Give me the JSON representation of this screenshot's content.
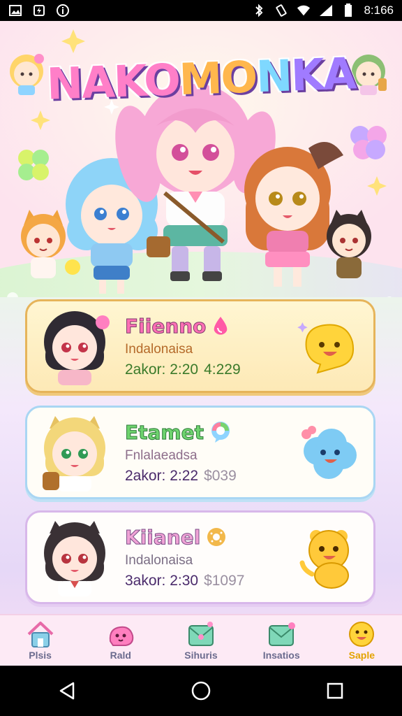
{
  "status_bar": {
    "time": "8:166",
    "left_icons": [
      "gallery-icon",
      "flash-icon",
      "info-icon"
    ],
    "right_icons": [
      "bluetooth-icon",
      "vibrate-icon",
      "wifi-icon",
      "signal-icon",
      "battery-icon"
    ]
  },
  "hero": {
    "title_parts": [
      "NAKO",
      "MO",
      "N",
      "KA"
    ],
    "title_full": "NAKOMONKA"
  },
  "cards": [
    {
      "name": "Fiienno",
      "subtitle": "Indalonaisa",
      "meta": "2akor: 2:20",
      "meta_extra": "4:229",
      "badge_icon": "droplet-icon",
      "mascot_icon": "yellow-blob-mascot-icon",
      "accent": "#ff6fb5"
    },
    {
      "name": "Etamet",
      "subtitle": "Fnlalaeadsa",
      "meta": "2akor: 2:22",
      "meta_extra": "$039",
      "badge_icon": "chat-bubble-icon",
      "mascot_icon": "blue-cloud-mascot-icon",
      "accent": "#6ed36e"
    },
    {
      "name": "Kiianel",
      "subtitle": "Indalonaisa",
      "meta": "3akor: 2:30",
      "meta_extra": "$1097",
      "badge_icon": "donut-icon",
      "mascot_icon": "yellow-bear-mascot-icon",
      "accent": "#f0a3d6"
    }
  ],
  "bottom_nav": [
    {
      "label": "Plsis",
      "icon": "home-icon",
      "active": false
    },
    {
      "label": "Rald",
      "icon": "pink-creature-icon",
      "active": false
    },
    {
      "label": "Sihuris",
      "icon": "mail-ribbon-icon",
      "active": false
    },
    {
      "label": "Insatios",
      "icon": "mail-icon",
      "active": false
    },
    {
      "label": "Saple",
      "icon": "smiley-icon",
      "active": true
    }
  ],
  "system_nav": [
    "back-icon",
    "home-circle-icon",
    "recents-icon"
  ]
}
